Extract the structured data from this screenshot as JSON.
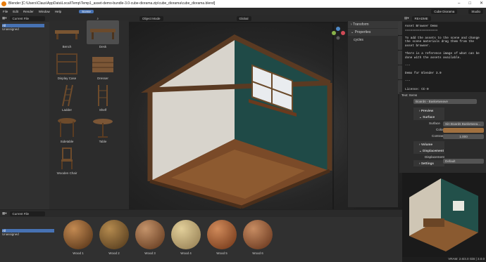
{
  "window": {
    "title": "Blender [C:\\Users\\Claus\\AppData\\Local\\Temp\\Temp1_asset-demo-bundle-3.0-cube-diorama.zip\\cube_diorama\\cube_diorama.blend]"
  },
  "menu": {
    "items": [
      "File",
      "Edit",
      "Render",
      "Window",
      "Help"
    ],
    "workspace": "Scene",
    "scene_field": "Cube Diorama",
    "studio_field": "Studio"
  },
  "asset_browser": {
    "library": "Current File",
    "sidebar": [
      "All",
      "Unassigned"
    ],
    "items": [
      {
        "name": "Bench"
      },
      {
        "name": "Desk"
      },
      {
        "name": "Display Case"
      },
      {
        "name": "Dresser"
      },
      {
        "name": "Ladder"
      },
      {
        "name": "Shelf"
      },
      {
        "name": "Sidetable"
      },
      {
        "name": "Table"
      },
      {
        "name": "Wooden Chair"
      }
    ]
  },
  "viewport": {
    "mode": "Object Mode",
    "orientation": "Global"
  },
  "npanel": {
    "transform": "Transform",
    "properties": "Properties",
    "cycles": "cycles",
    "tabs": [
      "Item",
      "Tool",
      "View",
      "Edit",
      "Sketchfab"
    ]
  },
  "text_editor": {
    "filename": "README",
    "lines": [
      "Asset Browser Demo",
      "==================",
      "",
      "To add the assets to the scene and change",
      "the scene materials drag them from the",
      "asset browser.",
      "",
      "There is a reference image of what can be",
      "done with the assets available.",
      "",
      "---",
      "",
      "Demo for Blender 3.0",
      "",
      "---",
      "",
      "License: CC-0"
    ]
  },
  "properties": {
    "title": "Text: Items",
    "material": "Boards - Basketweave",
    "sections": [
      "Preview",
      "Surface",
      "Volume",
      "Displacement",
      "Settings"
    ],
    "surface_label": "Surface",
    "surface_value": "Sin Boards Basketwea...",
    "color_label": "Color",
    "color_value": "#a0703f",
    "contrast_label": "Contrast",
    "contrast_value": "1.000",
    "displacement_label": "Displacement",
    "displacement_value": "Default"
  },
  "materials": {
    "library": "Current File",
    "sidebar": [
      "All",
      "Unassigned"
    ],
    "items": [
      {
        "name": "Wood 1"
      },
      {
        "name": "Wood 2"
      },
      {
        "name": "Wood 3"
      },
      {
        "name": "Wood 4"
      },
      {
        "name": "Wood 5"
      },
      {
        "name": "Wood 6"
      }
    ]
  },
  "status": {
    "vram": "VRAM: 2.6/4.0 GiB | 3.0.0"
  }
}
